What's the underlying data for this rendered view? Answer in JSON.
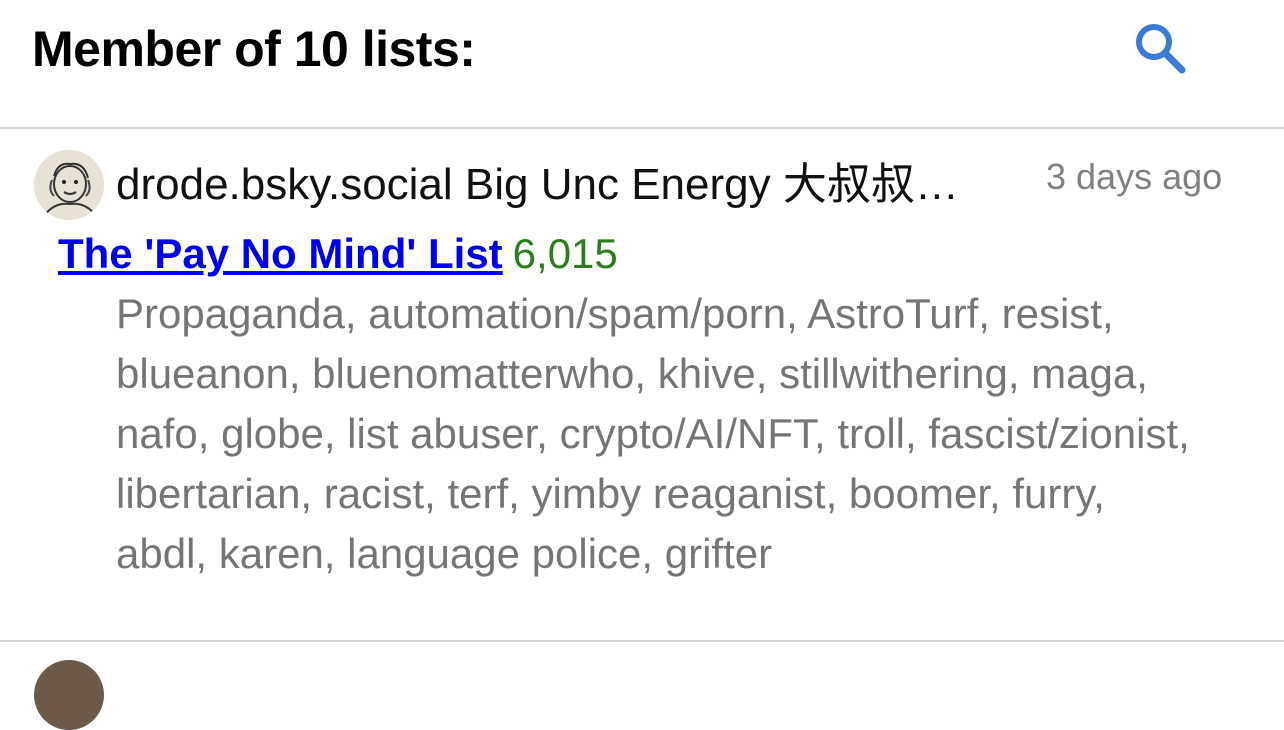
{
  "header": {
    "title": "Member of 10 lists:",
    "search_icon": "search-icon",
    "accent_color": "#3a7bd5"
  },
  "lists": [
    {
      "creator": "drode.bsky.social Big Unc Energy 大叔叔…",
      "timestamp": "3 days ago",
      "name": "The 'Pay No Mind' List",
      "member_count": "6,015",
      "description": "Propaganda, automation/spam/porn, AstroTurf, resist, blueanon, bluenomatterwho, khive, stillwithering, maga, nafo, globe, list abuser, crypto/AI/NFT, troll, fascist/zionist, libertarian, racist, terf, yimby reaganist, boomer, furry, abdl, karen, language police, grifter"
    }
  ],
  "colors": {
    "link": "#0000ee",
    "count": "#2e7d1c",
    "muted": "#757575"
  }
}
